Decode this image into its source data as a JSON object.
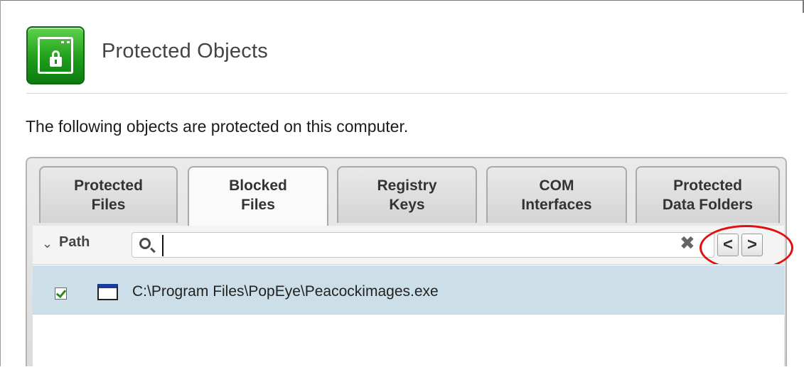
{
  "header": {
    "icon": "lock-window-icon",
    "title": "Protected Objects"
  },
  "description": "The following objects are protected on this computer.",
  "tabs": [
    {
      "line1": "Protected",
      "line2": "Files",
      "active": false
    },
    {
      "line1": "Blocked",
      "line2": "Files",
      "active": true
    },
    {
      "line1": "Registry",
      "line2": "Keys",
      "active": false
    },
    {
      "line1": "COM",
      "line2": "Interfaces",
      "active": false
    },
    {
      "line1": "Protected",
      "line2": "Data Folders",
      "active": false
    }
  ],
  "toolbar": {
    "collapse_glyph": "⌄",
    "column_label": "Path",
    "search_value": "",
    "clear_glyph": "✖",
    "prev_glyph": "<",
    "next_glyph": ">"
  },
  "list": {
    "rows": [
      {
        "checked": true,
        "icon": "exe-window-icon",
        "path": "C:\\Program Files\\PopEye\\Peacockimages.exe"
      }
    ]
  },
  "colors": {
    "accent_green": "#1f9e1c",
    "selected_row": "#ccdfe9",
    "highlight_red": "#e01010"
  }
}
